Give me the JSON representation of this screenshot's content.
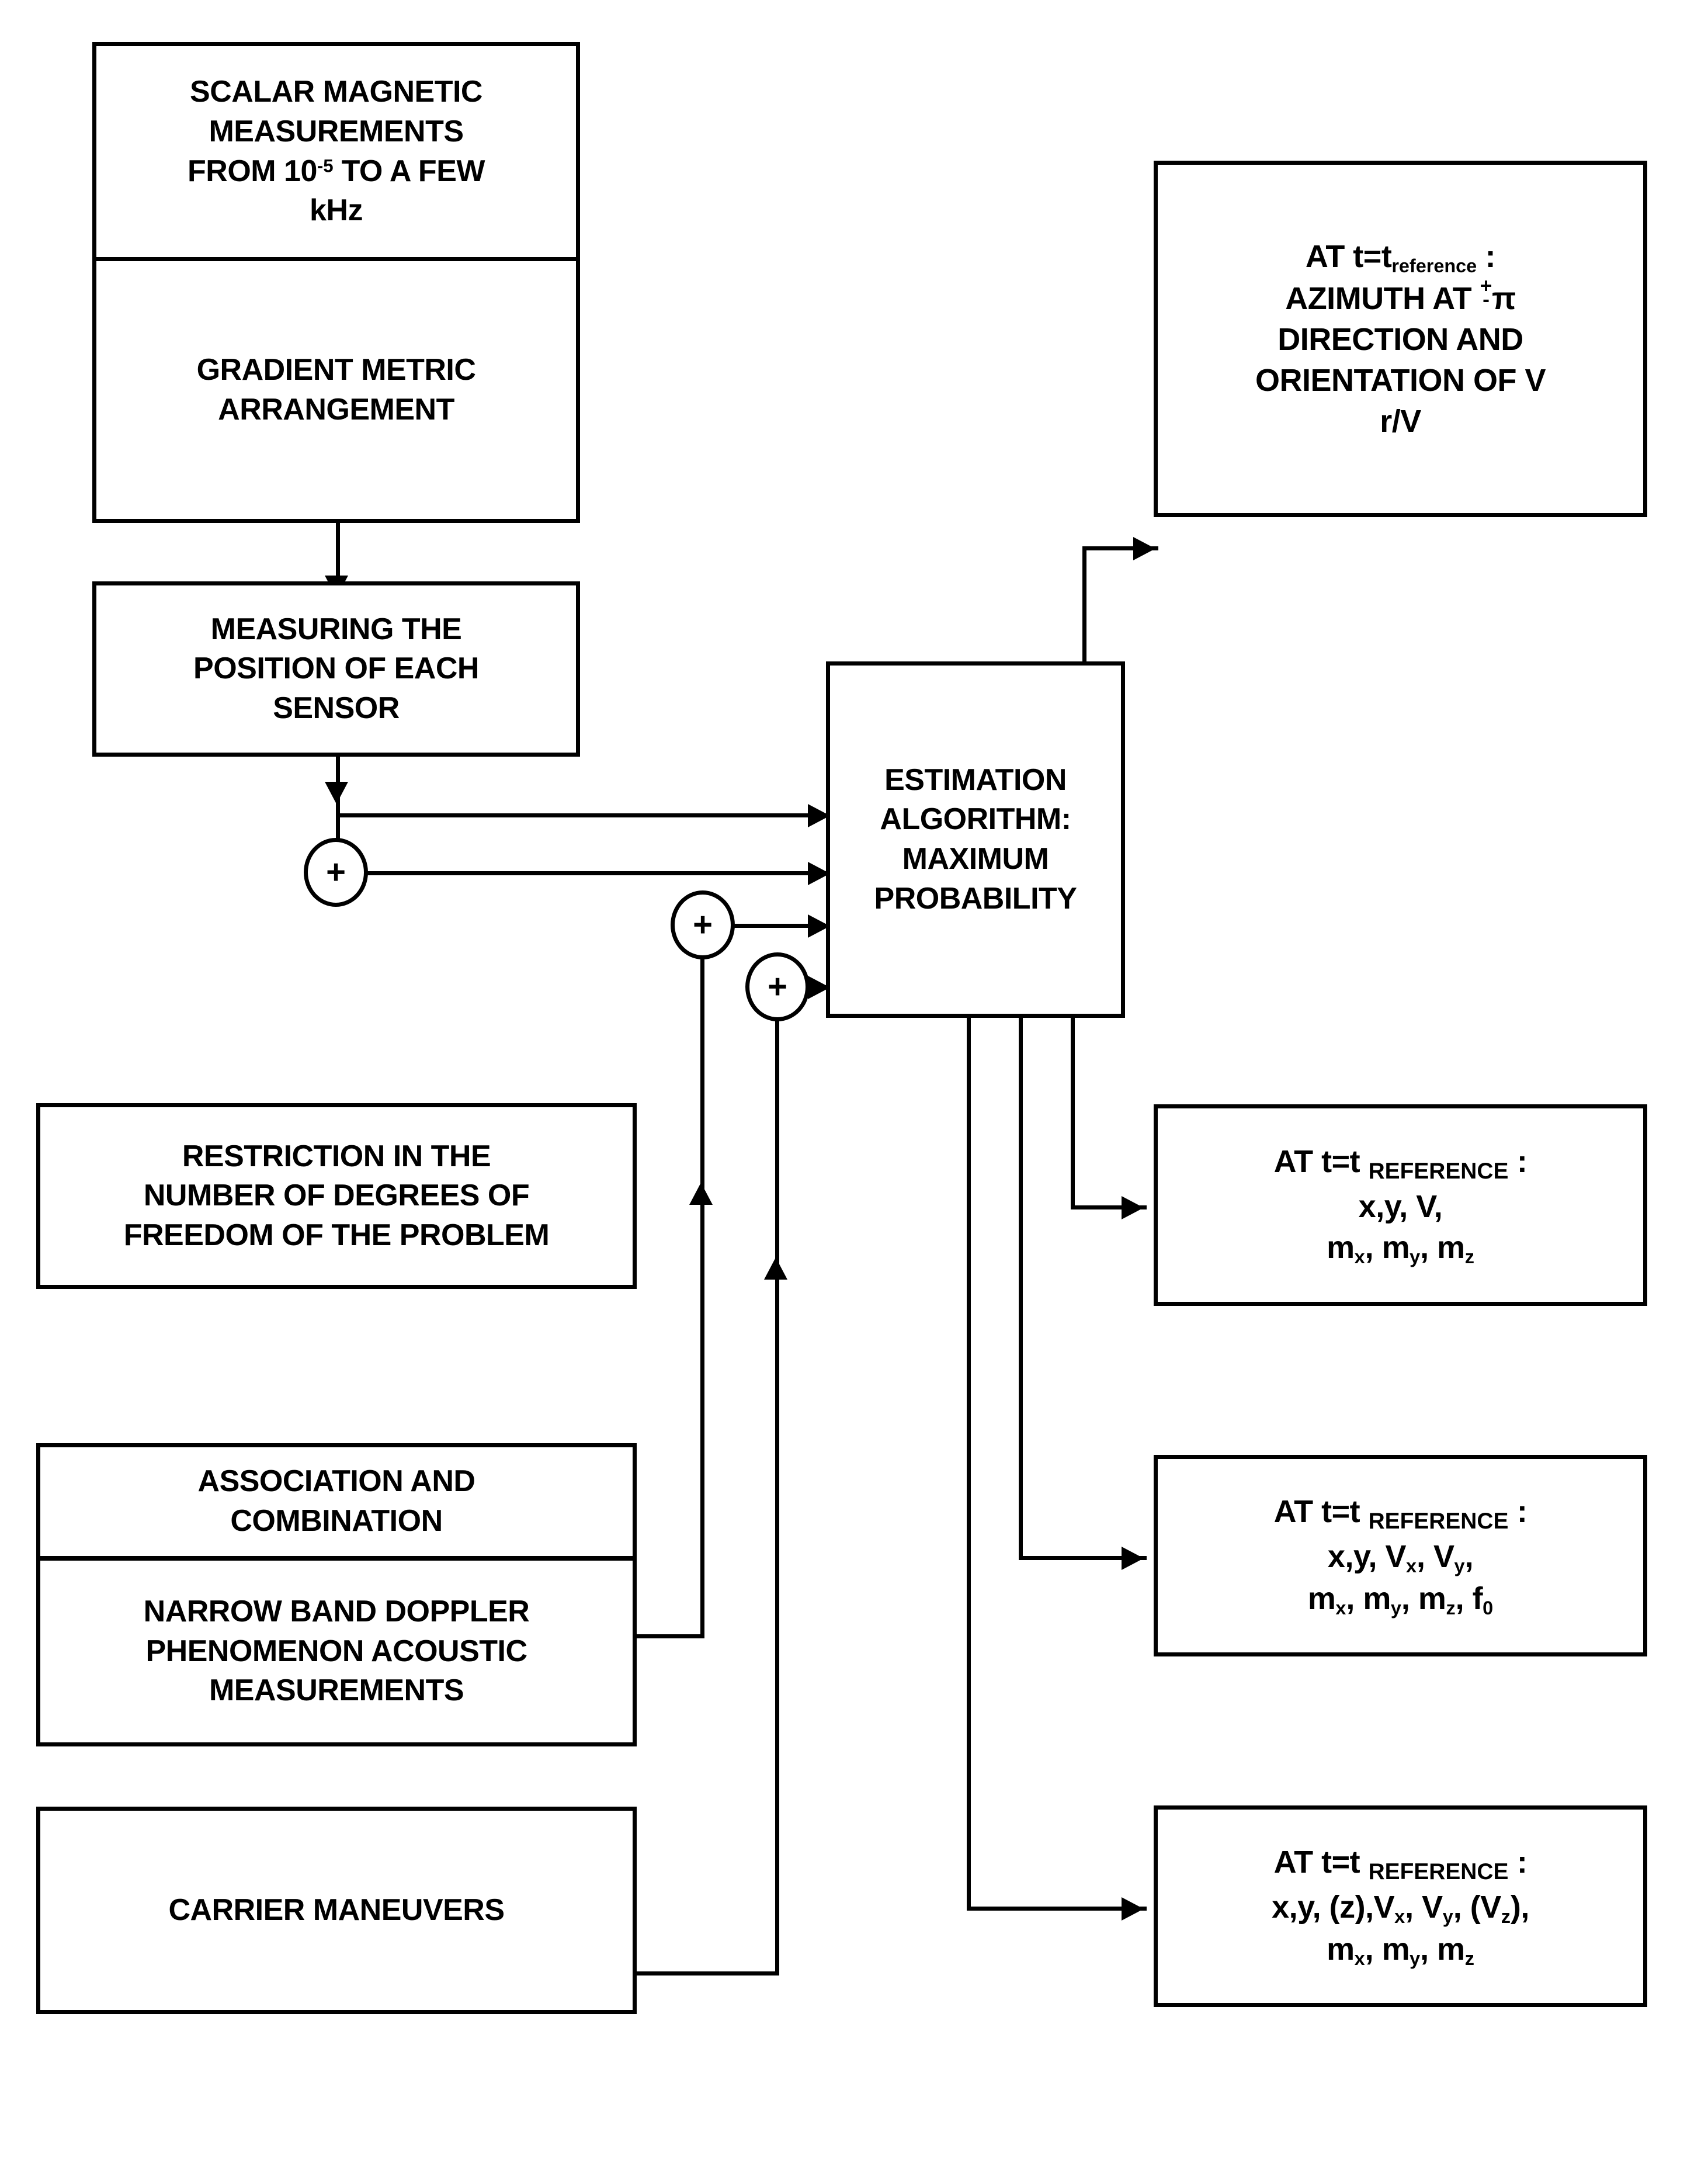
{
  "diagram": {
    "title": "Estimation algorithm block diagram",
    "stroke_color": "#000000",
    "background_color": "#ffffff"
  },
  "boxes": {
    "scalar_magnetic": {
      "lines": [
        "SCALAR MAGNETIC",
        "MEASUREMENTS",
        "FROM 10⁻⁵ TO A FEW",
        "kHz"
      ],
      "line1": "SCALAR MAGNETIC",
      "line2": "MEASUREMENTS",
      "line3_a": "FROM 10",
      "line3_sup": "-5",
      "line3_b": " TO A FEW",
      "line4": "kHz"
    },
    "gradient_metric": {
      "line1": "GRADIENT METRIC",
      "line2": "ARRANGEMENT"
    },
    "measuring_position": {
      "line1": "MEASURING THE",
      "line2": "POSITION OF EACH",
      "line3": "SENSOR"
    },
    "estimation_algorithm": {
      "line1": "ESTIMATION",
      "line2": "ALGORITHM:",
      "line3": "MAXIMUM",
      "line4": "PROBABILITY"
    },
    "restriction_dof": {
      "line1": "RESTRICTION IN THE",
      "line2": "NUMBER OF DEGREES OF",
      "line3": "FREEDOM OF THE PROBLEM"
    },
    "association_combination": {
      "line1": "ASSOCIATION AND",
      "line2": "COMBINATION"
    },
    "narrow_band_doppler": {
      "line1": "NARROW BAND DOPPLER",
      "line2": "PHENOMENON ACOUSTIC",
      "line3": "MEASUREMENTS"
    },
    "carrier_maneuvers": {
      "line1": "CARRIER MANEUVERS"
    },
    "output_azimuth": {
      "head_a": "AT t=t",
      "head_sub": "reference",
      "head_b": " :",
      "line2_a": "AZIMUTH AT ",
      "line2_pm_top": "+",
      "line2_pm_bot": "-",
      "line2_b": "π",
      "line3": "DIRECTION AND",
      "line4": "ORIENTATION OF V",
      "line5": "r/V"
    },
    "output_1": {
      "head_a": "AT t=t ",
      "head_sub": "REFERENCE",
      "head_b": " :",
      "line2": "x,y, V,",
      "line3_parts": [
        "m",
        "x",
        ", m",
        "y",
        ", m",
        "z"
      ]
    },
    "output_2": {
      "head_a": "AT t=t ",
      "head_sub": "REFERENCE",
      "head_b": " :",
      "line2_parts": [
        "x,y, V",
        "x",
        ", V",
        "y",
        ","
      ],
      "line3_parts": [
        "m",
        "x",
        ", m",
        "y",
        ", m",
        "z",
        ", f",
        "0"
      ]
    },
    "output_3": {
      "head_a": "AT t=t ",
      "head_sub": "REFERENCE",
      "head_b": " :",
      "line2_parts": [
        "x,y, (z),V",
        "x",
        ", V",
        "y",
        ", (V",
        "z",
        "),"
      ],
      "line3_parts": [
        "m",
        "x",
        ", m",
        "y",
        ", m",
        "z"
      ]
    }
  },
  "nodes": {
    "sum_1": {
      "label": "+"
    },
    "sum_2": {
      "label": "+"
    },
    "sum_3": {
      "label": "+"
    }
  }
}
